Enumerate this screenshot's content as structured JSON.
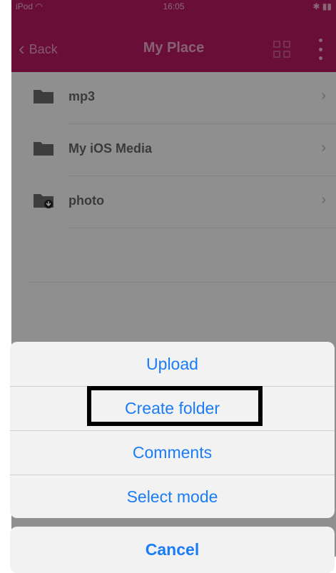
{
  "status": {
    "carrier": "iPod",
    "time": "16:05",
    "battery_icon": "battery-icon",
    "wifi_icon": "wifi-icon",
    "bluetooth_icon": "bluetooth-icon"
  },
  "navbar": {
    "back_label": "Back",
    "title": "My Place"
  },
  "folders": [
    {
      "name": "mp3"
    },
    {
      "name": "My iOS Media"
    },
    {
      "name": "photo"
    }
  ],
  "action_sheet": {
    "items": [
      "Upload",
      "Create folder",
      "Comments",
      "Select mode"
    ],
    "cancel_label": "Cancel"
  },
  "colors": {
    "nav_bar": "#b0185e",
    "action_text": "#1a7cf7"
  }
}
